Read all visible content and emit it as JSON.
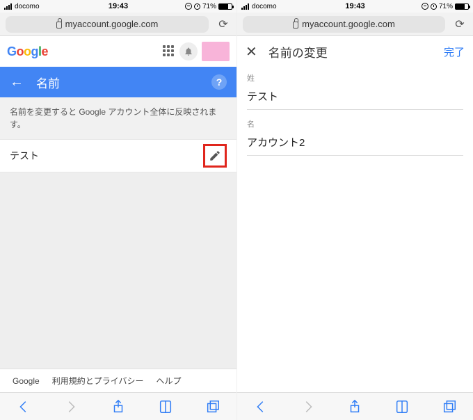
{
  "status": {
    "carrier": "docomo",
    "time": "19:43",
    "battery_pct": "71%"
  },
  "urlbar": {
    "domain": "myaccount.google.com"
  },
  "left": {
    "bluebar_title": "名前",
    "description": "名前を変更すると Google アカウント全体に反映されます。",
    "name_value": "テスト",
    "footer": {
      "google": "Google",
      "privacy": "利用規約とプライバシー",
      "help": "ヘルプ"
    }
  },
  "right": {
    "edit_title": "名前の変更",
    "done_label": "完了",
    "last_name_label": "姓",
    "last_name_value": "テスト",
    "first_name_label": "名",
    "first_name_value": "アカウント2"
  }
}
